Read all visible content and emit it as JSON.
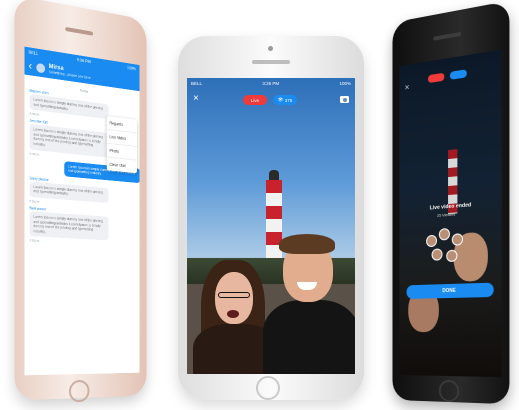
{
  "left_phone": {
    "status": {
      "carrier": "BELL",
      "time": "9:36 PM",
      "battery": "100%"
    },
    "header": {
      "back": "‹",
      "contact_name": "Mirsa",
      "contact_sub": "Something...please see here"
    },
    "dropdown": [
      "Regards",
      "Live Video",
      "Photo",
      "Clear chat"
    ],
    "day_label": "Today",
    "messages": [
      {
        "sender": "Bosses stars",
        "text": "Lorem Ipsum is simply dummy text of the printing and typesetting industry.",
        "meta": "8:45pm"
      },
      {
        "sender": "Jennifer Kid",
        "text": "Lorem Ipsum is simply dummy text of the printing and typesetting industry. Lorem Ipsum is simply dummy text of the printing and typesetting industry.",
        "meta": "8:48pm"
      },
      {
        "sender": "",
        "text": "Lorem Ipsum is simply dummy text of the printing and typesetting industry.",
        "meta": ""
      },
      {
        "sender": "Sorry please",
        "text": "Lorem Ipsum is simply dummy text of the printing and typesetting industry.",
        "meta": "8:55pm"
      },
      {
        "sender": "Best power",
        "text": "Lorem Ipsum is simply dummy text of the printing and typesetting industry. Lorem Ipsum is simply dummy text of the printing and typesetting industry.",
        "meta": "9:01pm"
      }
    ]
  },
  "middle_phone": {
    "status": {
      "carrier": "BELL",
      "time": "3:25 PM",
      "battery": "100%"
    },
    "close": "×",
    "live_label": "Live",
    "viewers": "375"
  },
  "right_phone": {
    "close": "×",
    "ended_title": "Live video ended",
    "ended_count": "25 Viewers",
    "done_label": "DONE"
  }
}
